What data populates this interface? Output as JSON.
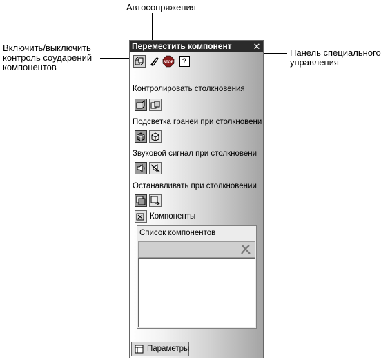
{
  "callouts": {
    "autosnap": "Автосопряжения",
    "collision_toggle": [
      "Включить/выключить",
      "контроль соударений",
      "компонентов"
    ],
    "special_panel": [
      "Панель специального",
      "управления"
    ]
  },
  "panel": {
    "title": "Переместить компонент",
    "close_glyph": "✕",
    "toolbar": {
      "stop_label": "STOP",
      "help_label": "?"
    },
    "sections": [
      {
        "label": "Контролировать столкновения"
      },
      {
        "label": "Подсветка граней при столкновени"
      },
      {
        "label": "Звуковой сигнал при столкновени"
      },
      {
        "label": "Останавливать при столкновении"
      }
    ],
    "components_label": "Компоненты",
    "list": {
      "title": "Список компонентов"
    },
    "tab_label": "Параметры"
  },
  "colors": {
    "titlebar": "#2b2b2b",
    "stop_red": "#8b1c1c"
  }
}
